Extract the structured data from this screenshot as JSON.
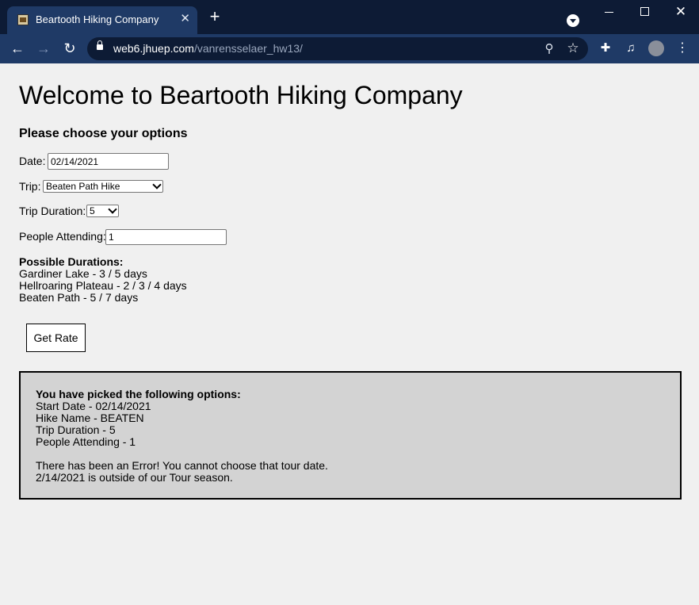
{
  "browser": {
    "tab_title": "Beartooth Hiking Company",
    "url_host": "web6.jhuep.com",
    "url_path": "/vanrensselaer_hw13/"
  },
  "page": {
    "title": "Welcome to Beartooth Hiking Company",
    "subheading": "Please choose your options",
    "date_label": "Date:",
    "date_value": "02/14/2021",
    "trip_label": "Trip:",
    "trip_selected": "Beaten Path Hike",
    "duration_label": "Trip Duration:",
    "duration_selected": "5",
    "people_label": "People Attending:",
    "people_value": "1",
    "durations_heading": "Possible Durations:",
    "durations": [
      "Gardiner Lake - 3 / 5 days",
      "Hellroaring Plateau - 2 / 3 / 4 days",
      "Beaten Path - 5 / 7 days"
    ],
    "get_rate_label": "Get Rate"
  },
  "result": {
    "heading": "You have picked the following options:",
    "lines": [
      "Start Date - 02/14/2021",
      "Hike Name - BEATEN",
      "Trip Duration - 5",
      "People Attending - 1"
    ],
    "error_lines": [
      "There has been an Error! You cannot choose that tour date.",
      "2/14/2021 is outside of our Tour season."
    ]
  }
}
